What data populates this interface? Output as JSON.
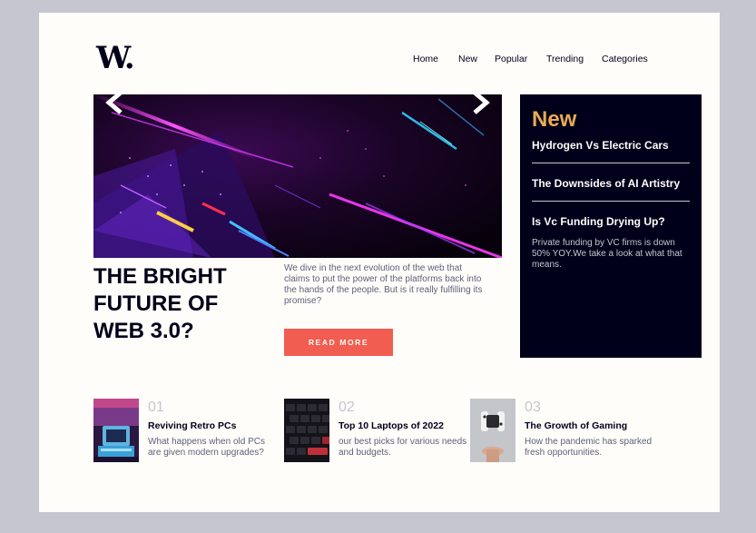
{
  "logo": {
    "text": "W."
  },
  "nav": {
    "items": [
      "Home",
      "New",
      "Popular",
      "Trending",
      "Categories"
    ]
  },
  "hero": {
    "headline": "THE BRIGHT FUTURE OF WEB 3.0?",
    "description": "We dive in the next evolution of the web that claims to put the power of the platforms back into the hands of the people. But is it really fulfilling its promise?",
    "cta": "READ MORE",
    "prev_icon": "chevron-left-icon",
    "next_icon": "chevron-right-icon"
  },
  "new_panel": {
    "title": "New",
    "items": [
      {
        "title": "Hydrogen Vs Electric Cars"
      },
      {
        "title": "The Downsides of AI Artistry"
      },
      {
        "title": "Is Vc Funding Drying Up?",
        "desc": "Private funding by VC firms is down 50% YOY.We take a look at what that means."
      }
    ]
  },
  "cards": [
    {
      "num": "01",
      "title": "Reviving Retro PCs",
      "desc": "What happens when old PCs are given modern upgrades?"
    },
    {
      "num": "02",
      "title": "Top 10 Laptops of 2022",
      "desc": "our best picks for various needs and budgets."
    },
    {
      "num": "03",
      "title": "The Growth of Gaming",
      "desc": "How the pandemic has sparked fresh opportunities."
    }
  ],
  "colors": {
    "off_white": "#fffdf9",
    "dark_navy": "#00001a",
    "soft_orange": "#e9ab53",
    "soft_red": "#f15d51",
    "grayish_blue": "#5d5f79",
    "grayish_light": "#c5c6d0"
  }
}
